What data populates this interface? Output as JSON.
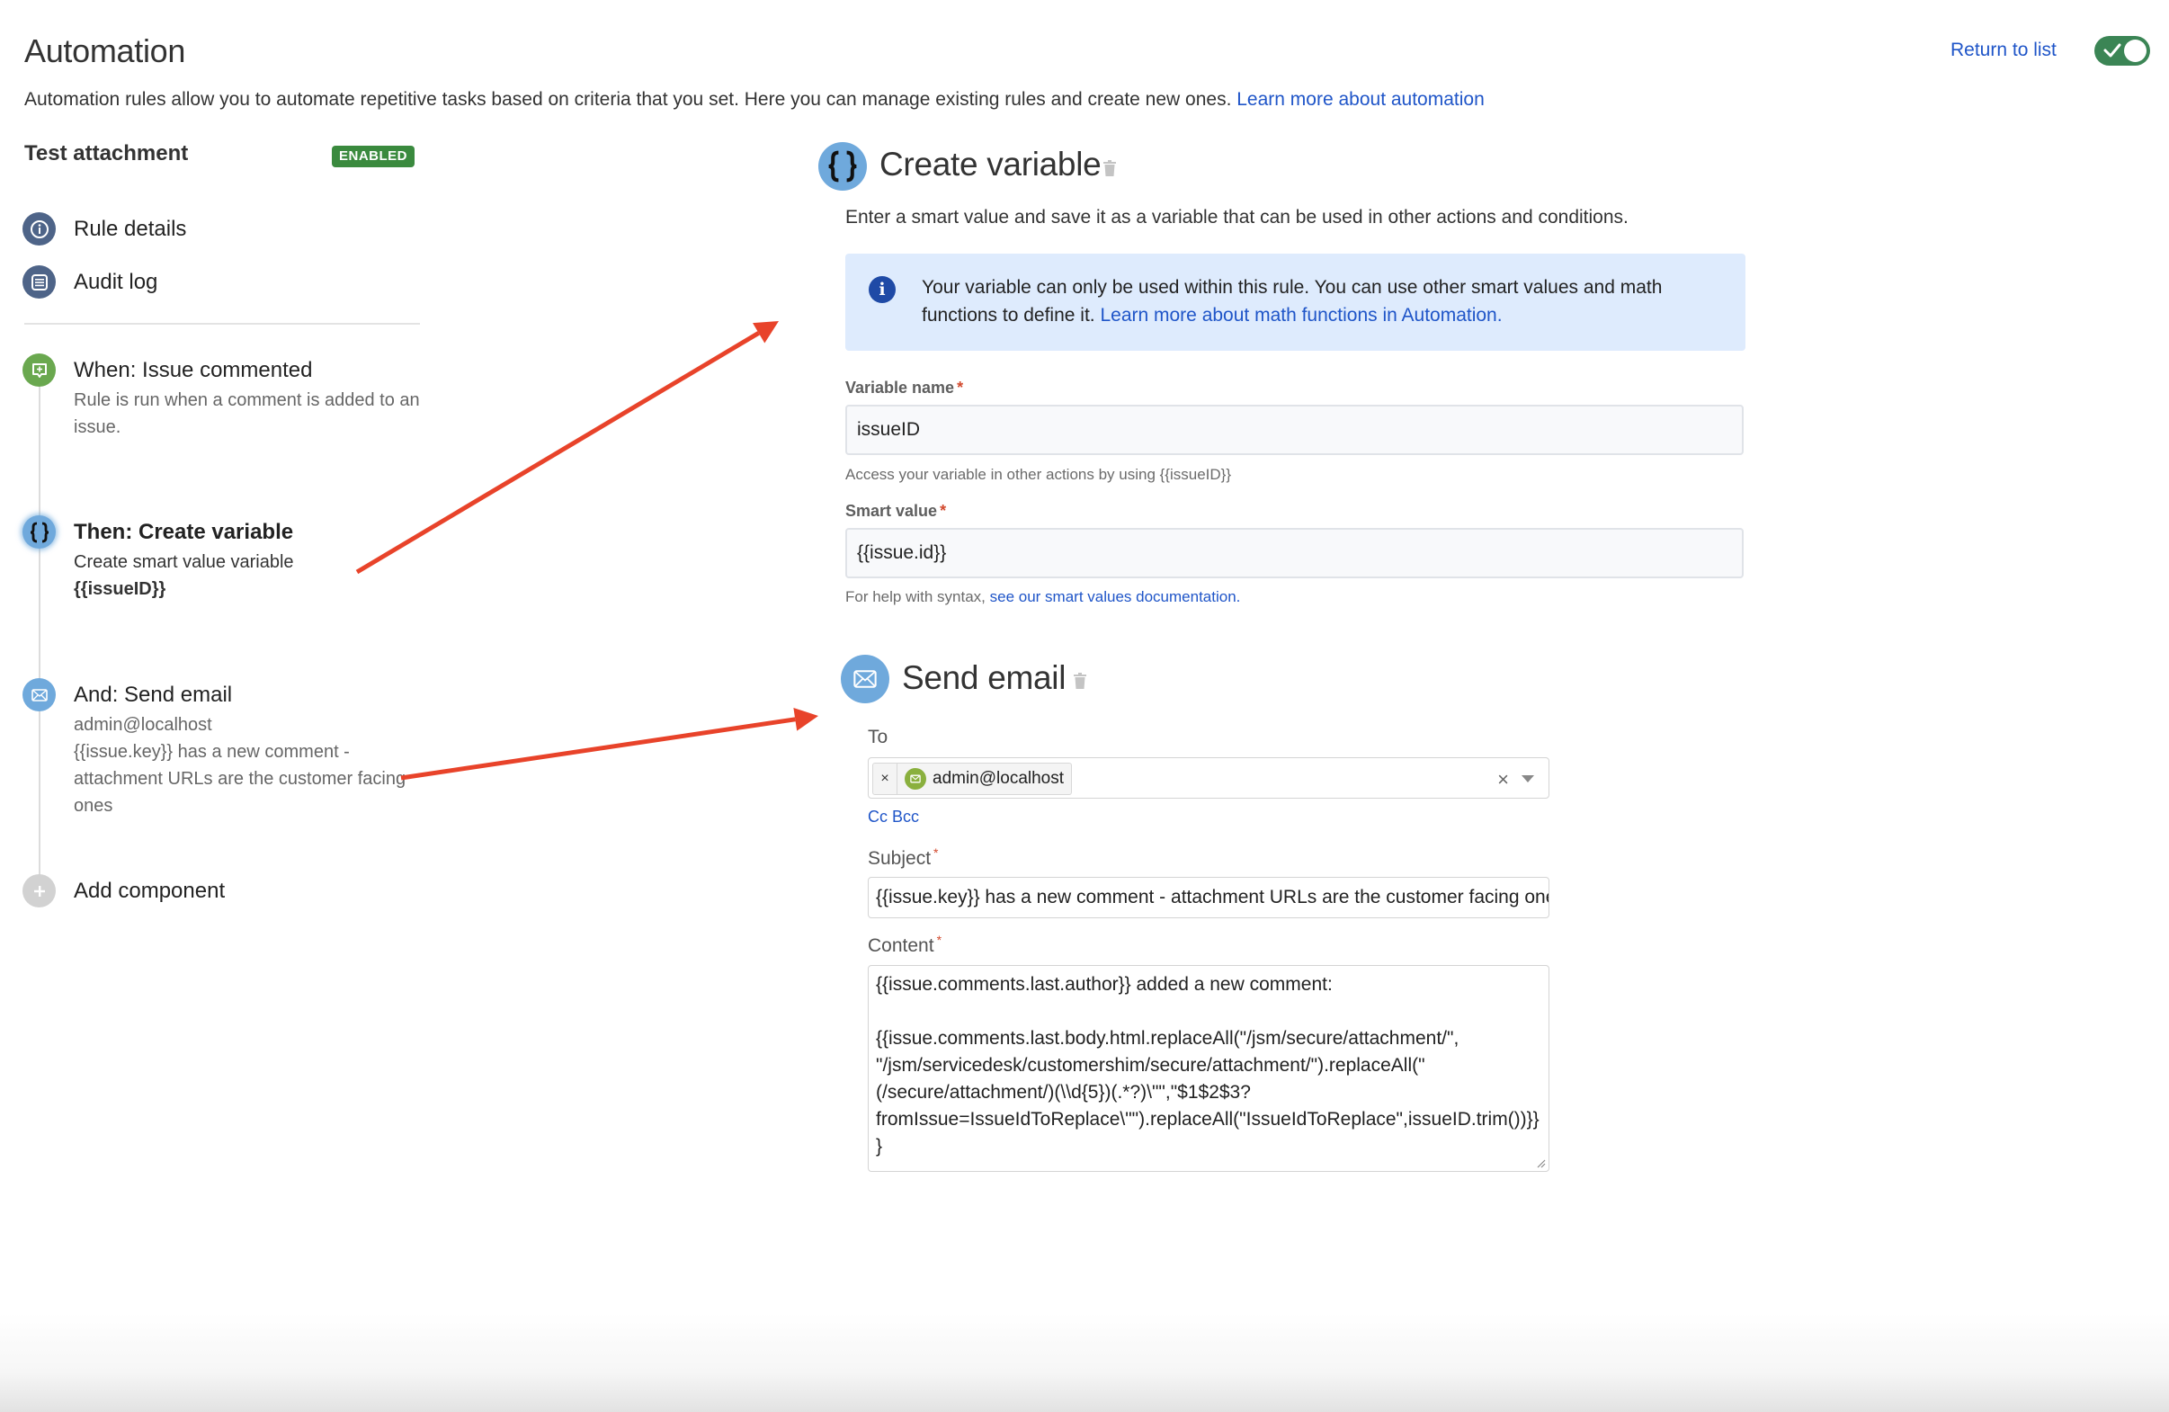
{
  "header": {
    "title": "Automation",
    "description": "Automation rules allow you to automate repetitive tasks based on criteria that you set. Here you can manage existing rules and create new ones. ",
    "learn_more_link": "Learn more about automation",
    "return_link": "Return to list",
    "rule_enabled_toggle": true
  },
  "sidebar": {
    "rule_name": "Test attachment",
    "status_badge": "ENABLED",
    "nav": [
      {
        "label": "Rule details",
        "icon": "info-icon"
      },
      {
        "label": "Audit log",
        "icon": "list-icon"
      }
    ],
    "components": [
      {
        "title": "When: Issue commented",
        "icon": "comment-add-icon",
        "lines": [
          "Rule is run when a comment is added to an issue."
        ]
      },
      {
        "title": "Then: Create variable",
        "icon": "braces-icon",
        "lines": [
          "Create smart value variable",
          "{{issueID}}"
        ],
        "selected": true
      },
      {
        "title": "And: Send email",
        "icon": "envelope-icon",
        "lines": [
          "admin@localhost",
          "{{issue.key}} has a new comment - attachment URLs are the customer facing ones"
        ]
      }
    ],
    "add_component": "Add component"
  },
  "create_variable": {
    "title": "Create variable",
    "description": "Enter a smart value and save it as a variable that can be used in other actions and conditions.",
    "info_text": "Your variable can only be used within this rule. You can use other smart values and math functions to define it. ",
    "info_link": "Learn more about math functions in Automation.",
    "variable_name_label": "Variable name",
    "variable_name_value": "issueID",
    "variable_name_helper": "Access your variable in other actions by using {{issueID}}",
    "smart_value_label": "Smart value",
    "smart_value_value": "{{issue.id}}",
    "smart_value_helper": "For help with syntax, ",
    "smart_value_link": "see our smart values documentation."
  },
  "send_email": {
    "title": "Send email",
    "to_label": "To",
    "to_recipients": [
      "admin@localhost"
    ],
    "chip_remove": "×",
    "clear_symbol": "×",
    "cc_bcc_link": "Cc Bcc",
    "subject_label": "Subject",
    "subject_value": "{{issue.key}} has a new comment - attachment URLs are the customer facing ones",
    "content_label": "Content",
    "content_value": "{{issue.comments.last.author}} added a new comment:\n\n{{issue.comments.last.body.html.replaceAll(\"/jsm/secure/attachment/\", \"/jsm/servicedesk/customershim/secure/attachment/\").replaceAll(\"(/secure/attachment/)(\\\\d{5})(.*?)\\\"\",\"$1$2$3?fromIssue=IssueIdToReplace\\\"\").replaceAll(\"IssueIdToReplace\",issueID.trim())}}\n}"
  },
  "annotations": {
    "arrow_color": "#e8432a"
  },
  "colors": {
    "link": "#1f55c8",
    "enabled_green": "#3a8a3e",
    "toggle_green": "#3b8555",
    "info_bg": "#deebfd",
    "component_blue": "#6fa9dc",
    "trigger_green": "#6aa84f"
  }
}
